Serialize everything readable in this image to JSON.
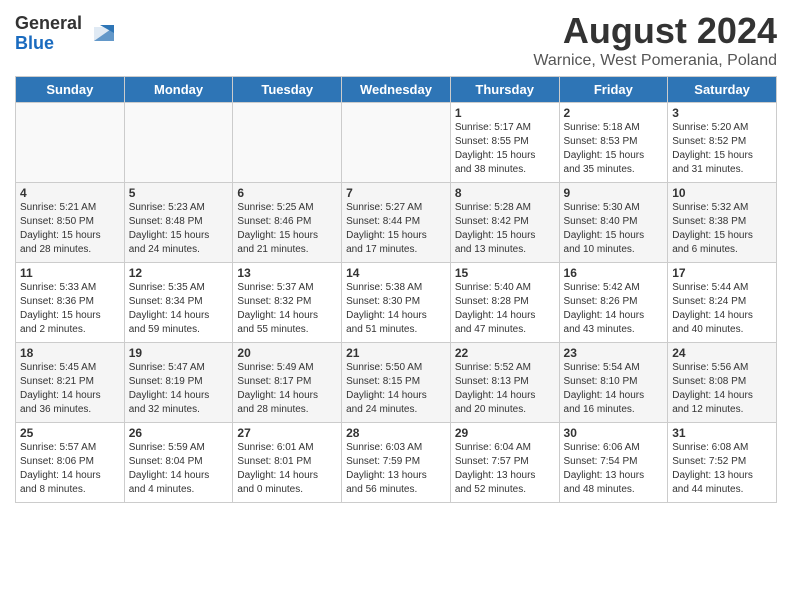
{
  "header": {
    "logo_general": "General",
    "logo_blue": "Blue",
    "title": "August 2024",
    "subtitle": "Warnice, West Pomerania, Poland"
  },
  "days_of_week": [
    "Sunday",
    "Monday",
    "Tuesday",
    "Wednesday",
    "Thursday",
    "Friday",
    "Saturday"
  ],
  "weeks": [
    [
      {
        "day": "",
        "info": ""
      },
      {
        "day": "",
        "info": ""
      },
      {
        "day": "",
        "info": ""
      },
      {
        "day": "",
        "info": ""
      },
      {
        "day": "1",
        "info": "Sunrise: 5:17 AM\nSunset: 8:55 PM\nDaylight: 15 hours\nand 38 minutes."
      },
      {
        "day": "2",
        "info": "Sunrise: 5:18 AM\nSunset: 8:53 PM\nDaylight: 15 hours\nand 35 minutes."
      },
      {
        "day": "3",
        "info": "Sunrise: 5:20 AM\nSunset: 8:52 PM\nDaylight: 15 hours\nand 31 minutes."
      }
    ],
    [
      {
        "day": "4",
        "info": "Sunrise: 5:21 AM\nSunset: 8:50 PM\nDaylight: 15 hours\nand 28 minutes."
      },
      {
        "day": "5",
        "info": "Sunrise: 5:23 AM\nSunset: 8:48 PM\nDaylight: 15 hours\nand 24 minutes."
      },
      {
        "day": "6",
        "info": "Sunrise: 5:25 AM\nSunset: 8:46 PM\nDaylight: 15 hours\nand 21 minutes."
      },
      {
        "day": "7",
        "info": "Sunrise: 5:27 AM\nSunset: 8:44 PM\nDaylight: 15 hours\nand 17 minutes."
      },
      {
        "day": "8",
        "info": "Sunrise: 5:28 AM\nSunset: 8:42 PM\nDaylight: 15 hours\nand 13 minutes."
      },
      {
        "day": "9",
        "info": "Sunrise: 5:30 AM\nSunset: 8:40 PM\nDaylight: 15 hours\nand 10 minutes."
      },
      {
        "day": "10",
        "info": "Sunrise: 5:32 AM\nSunset: 8:38 PM\nDaylight: 15 hours\nand 6 minutes."
      }
    ],
    [
      {
        "day": "11",
        "info": "Sunrise: 5:33 AM\nSunset: 8:36 PM\nDaylight: 15 hours\nand 2 minutes."
      },
      {
        "day": "12",
        "info": "Sunrise: 5:35 AM\nSunset: 8:34 PM\nDaylight: 14 hours\nand 59 minutes."
      },
      {
        "day": "13",
        "info": "Sunrise: 5:37 AM\nSunset: 8:32 PM\nDaylight: 14 hours\nand 55 minutes."
      },
      {
        "day": "14",
        "info": "Sunrise: 5:38 AM\nSunset: 8:30 PM\nDaylight: 14 hours\nand 51 minutes."
      },
      {
        "day": "15",
        "info": "Sunrise: 5:40 AM\nSunset: 8:28 PM\nDaylight: 14 hours\nand 47 minutes."
      },
      {
        "day": "16",
        "info": "Sunrise: 5:42 AM\nSunset: 8:26 PM\nDaylight: 14 hours\nand 43 minutes."
      },
      {
        "day": "17",
        "info": "Sunrise: 5:44 AM\nSunset: 8:24 PM\nDaylight: 14 hours\nand 40 minutes."
      }
    ],
    [
      {
        "day": "18",
        "info": "Sunrise: 5:45 AM\nSunset: 8:21 PM\nDaylight: 14 hours\nand 36 minutes."
      },
      {
        "day": "19",
        "info": "Sunrise: 5:47 AM\nSunset: 8:19 PM\nDaylight: 14 hours\nand 32 minutes."
      },
      {
        "day": "20",
        "info": "Sunrise: 5:49 AM\nSunset: 8:17 PM\nDaylight: 14 hours\nand 28 minutes."
      },
      {
        "day": "21",
        "info": "Sunrise: 5:50 AM\nSunset: 8:15 PM\nDaylight: 14 hours\nand 24 minutes."
      },
      {
        "day": "22",
        "info": "Sunrise: 5:52 AM\nSunset: 8:13 PM\nDaylight: 14 hours\nand 20 minutes."
      },
      {
        "day": "23",
        "info": "Sunrise: 5:54 AM\nSunset: 8:10 PM\nDaylight: 14 hours\nand 16 minutes."
      },
      {
        "day": "24",
        "info": "Sunrise: 5:56 AM\nSunset: 8:08 PM\nDaylight: 14 hours\nand 12 minutes."
      }
    ],
    [
      {
        "day": "25",
        "info": "Sunrise: 5:57 AM\nSunset: 8:06 PM\nDaylight: 14 hours\nand 8 minutes."
      },
      {
        "day": "26",
        "info": "Sunrise: 5:59 AM\nSunset: 8:04 PM\nDaylight: 14 hours\nand 4 minutes."
      },
      {
        "day": "27",
        "info": "Sunrise: 6:01 AM\nSunset: 8:01 PM\nDaylight: 14 hours\nand 0 minutes."
      },
      {
        "day": "28",
        "info": "Sunrise: 6:03 AM\nSunset: 7:59 PM\nDaylight: 13 hours\nand 56 minutes."
      },
      {
        "day": "29",
        "info": "Sunrise: 6:04 AM\nSunset: 7:57 PM\nDaylight: 13 hours\nand 52 minutes."
      },
      {
        "day": "30",
        "info": "Sunrise: 6:06 AM\nSunset: 7:54 PM\nDaylight: 13 hours\nand 48 minutes."
      },
      {
        "day": "31",
        "info": "Sunrise: 6:08 AM\nSunset: 7:52 PM\nDaylight: 13 hours\nand 44 minutes."
      }
    ]
  ]
}
